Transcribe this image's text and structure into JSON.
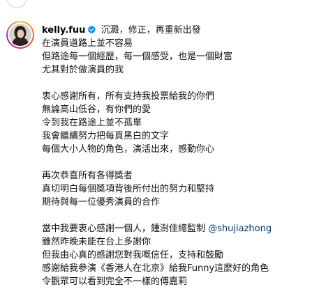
{
  "post": {
    "username": "kelly.fuu",
    "verified_icon": "verified-badge-icon",
    "avatar_icon": "profile-photo",
    "colors": {
      "verified": "#0095f6",
      "mention": "#00376b",
      "text": "#111111"
    },
    "caption": {
      "line_1": "沉澱，修正，再重新出發",
      "line_2": "在演員道路上並不容易",
      "line_3": "但路途每一個經歷，每一個感受，也是一個財富",
      "line_4": "尤其對於做演員的我",
      "line_5": "衷心感謝所有，所有支持我投票給我的你們",
      "line_6": "無論高山低谷，有你們的愛",
      "line_7": "令到我在路途上並不孤單",
      "line_8": "我會繼續努力把每頁黑白的文字",
      "line_9": "每個大小人物的角色，演活出來，感動你心",
      "line_10": "再次恭喜所有各得獎者",
      "line_11": "真切明白每個獎項背後所付出的努力和堅持",
      "line_12": "期待與每一位優秀演員的合作",
      "line_13_text": "當中我要衷心感謝一個人，鍾澍佳總監制 ",
      "line_13_mention": "@shujiazhong",
      "line_14": "雖然昨晚未能在台上多謝你",
      "line_15": "但我由心真的感謝您對我嘅信任，支持和鼓勵",
      "line_16": "感謝給我參演《香港人在北京》給我Funny這麼好的角色",
      "line_17": "令觀眾可以看到完全不一樣的傅嘉莉"
    }
  }
}
